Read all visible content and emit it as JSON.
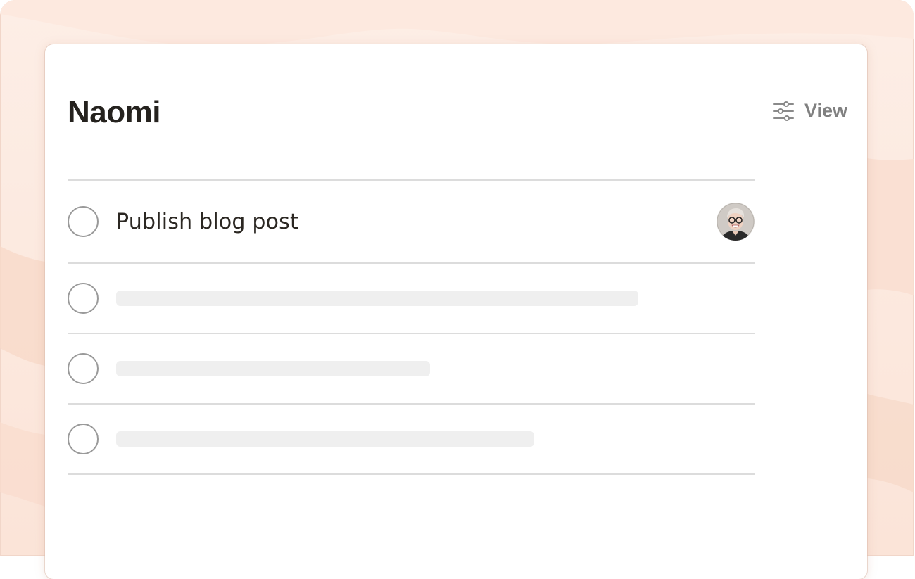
{
  "header": {
    "title": "Naomi",
    "view_label": "View"
  },
  "tasks": [
    {
      "label": "Publish blog post",
      "has_assignee": true
    },
    {
      "label": "",
      "placeholder_fraction": 0.76
    },
    {
      "label": "",
      "placeholder_fraction": 0.457
    },
    {
      "label": "",
      "placeholder_fraction": 0.609
    }
  ],
  "icons": {
    "view": "sliders-icon",
    "checkbox": "circle-checkbox-icon",
    "assignee": "avatar"
  },
  "colors": {
    "background_peach": "#fbe4d8",
    "card": "#ffffff",
    "title_text": "#25221e",
    "muted_text": "#808080",
    "divider": "#dcdcdc",
    "placeholder": "#efefef"
  }
}
